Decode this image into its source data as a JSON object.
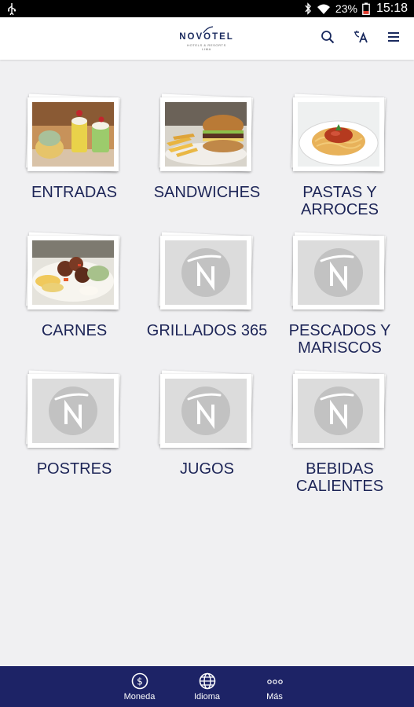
{
  "status_bar": {
    "battery_percent": "23%",
    "time": "15:18",
    "icons": [
      "usb-icon",
      "bluetooth-icon",
      "wifi-icon",
      "battery-icon"
    ]
  },
  "header": {
    "logo_text": "NOVOTEL",
    "logo_subtext": "HOTELS & RESORTS",
    "logo_subtext2": "LIMA",
    "actions": [
      {
        "name": "search-icon"
      },
      {
        "name": "translate-icon"
      },
      {
        "name": "menu-icon"
      }
    ]
  },
  "categories": [
    {
      "label": "ENTRADAS",
      "image": "entradas-photo"
    },
    {
      "label": "SANDWICHES",
      "image": "sandwich-photo"
    },
    {
      "label": "PASTAS Y ARROCES",
      "image": "pasta-photo"
    },
    {
      "label": "CARNES",
      "image": "carnes-photo"
    },
    {
      "label": "GRILLADOS 365",
      "image": "novotel-placeholder"
    },
    {
      "label": "PESCADOS Y MARISCOS",
      "image": "novotel-placeholder"
    },
    {
      "label": "POSTRES",
      "image": "novotel-placeholder"
    },
    {
      "label": "JUGOS",
      "image": "novotel-placeholder"
    },
    {
      "label": "BEBIDAS CALIENTES",
      "image": "novotel-placeholder"
    }
  ],
  "bottom_nav": [
    {
      "label": "Moneda",
      "icon": "currency-icon"
    },
    {
      "label": "Idioma",
      "icon": "globe-icon"
    },
    {
      "label": "Más",
      "icon": "more-dots-icon"
    }
  ],
  "colors": {
    "brand_navy": "#1d2366",
    "label_text": "#1d2557",
    "background": "#f0f0f2"
  }
}
